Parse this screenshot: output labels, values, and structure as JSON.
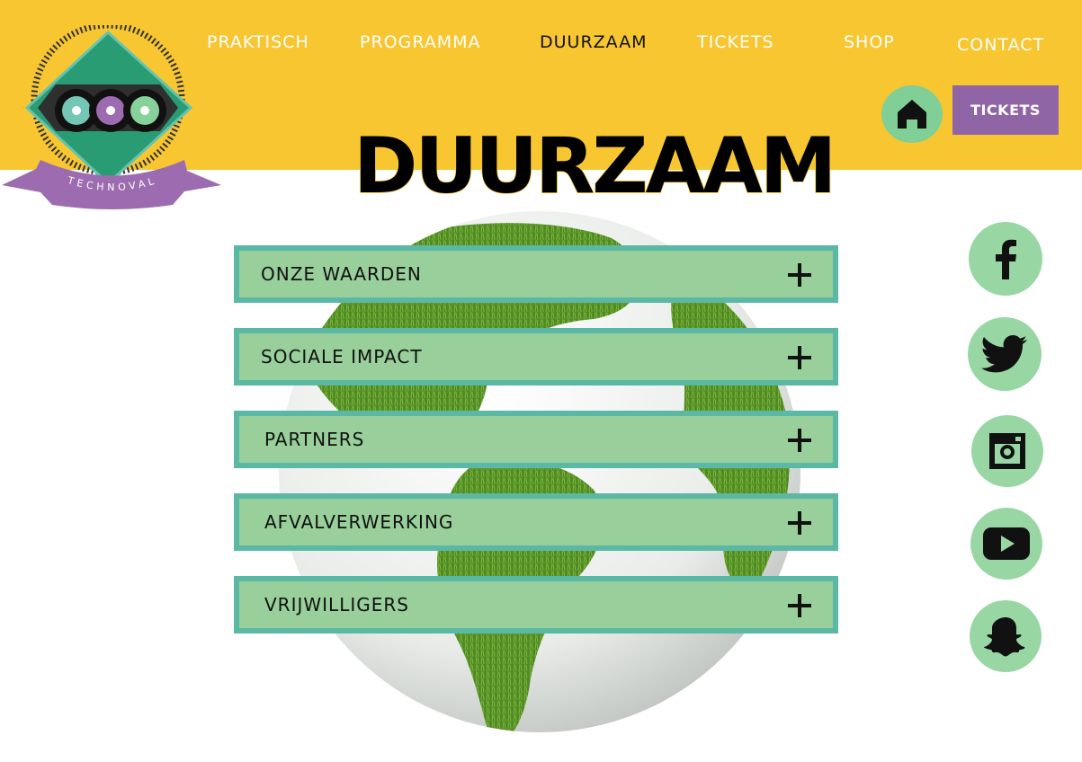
{
  "nav": {
    "items": [
      {
        "label": "PRAKTISCH"
      },
      {
        "label": "PROGRAMMA"
      },
      {
        "label": "DUURZAAM"
      },
      {
        "label": "TICKETS"
      },
      {
        "label": "SHOP"
      },
      {
        "label": "CONTACT"
      }
    ],
    "active": "DUURZAAM"
  },
  "header": {
    "home_icon": "home-icon",
    "tickets_button": "TICKETS"
  },
  "logo": {
    "text": "TECHNOVAL"
  },
  "page": {
    "title": "DUURZAAM"
  },
  "accordion": {
    "items": [
      {
        "label": "ONZE WAARDEN"
      },
      {
        "label": "SOCIALE IMPACT"
      },
      {
        "label": "PARTNERS"
      },
      {
        "label": "AFVALVERWERKING"
      },
      {
        "label": "VRIJWILLIGERS"
      }
    ],
    "expand_icon": "plus-icon"
  },
  "social": [
    "facebook-icon",
    "twitter-icon",
    "instagram-icon",
    "youtube-icon",
    "snapchat-icon"
  ],
  "colors": {
    "header_bg": "#f7c631",
    "accent_purple": "#9065a6",
    "accent_green": "#98cf9a",
    "border_teal": "#5bb8a4"
  }
}
